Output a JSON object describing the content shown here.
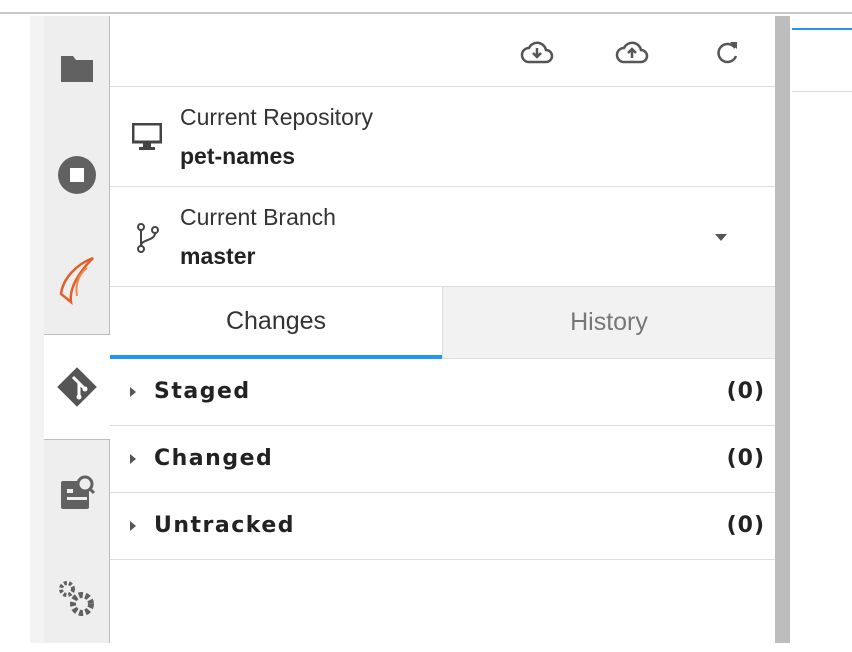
{
  "toolbar": {
    "icons": [
      "cloud-download-icon",
      "cloud-upload-icon",
      "refresh-icon"
    ]
  },
  "repository": {
    "label": "Current Repository",
    "value": "pet-names"
  },
  "branch": {
    "label": "Current Branch",
    "value": "master"
  },
  "tabs": [
    {
      "label": "Changes",
      "active": true
    },
    {
      "label": "History",
      "active": false
    }
  ],
  "sections": [
    {
      "name": "Staged",
      "count": "(0)"
    },
    {
      "name": "Changed",
      "count": "(0)"
    },
    {
      "name": "Untracked",
      "count": "(0)"
    }
  ],
  "colors": {
    "accent": "#2196f3",
    "icon": "#616161"
  }
}
